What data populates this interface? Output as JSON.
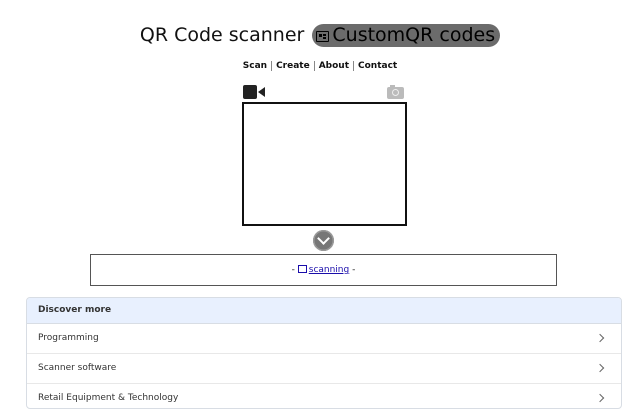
{
  "header": {
    "title": "QR Code scanner",
    "pill_label": "CustomQR codes",
    "pill_icon": "id-card-icon"
  },
  "nav": {
    "items": [
      {
        "label": "Scan"
      },
      {
        "label": "Create"
      },
      {
        "label": "About"
      },
      {
        "label": "Contact"
      }
    ]
  },
  "scanner": {
    "video_icon": "video-camera-icon",
    "camera_icon": "photo-camera-icon",
    "toggle_icon": "chevron-down-circle-icon"
  },
  "result": {
    "prefix": "- ",
    "link_text": "scanning",
    "suffix": " -"
  },
  "discover": {
    "header": "Discover more",
    "items": [
      {
        "label": "Programming"
      },
      {
        "label": "Scanner software"
      },
      {
        "label": "Retail Equipment & Technology"
      }
    ]
  }
}
